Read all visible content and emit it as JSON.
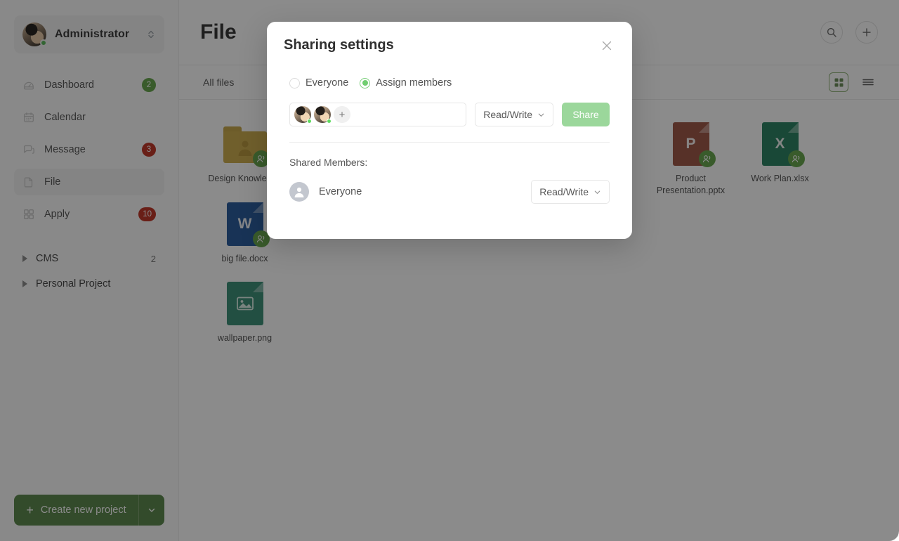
{
  "sidebar": {
    "user": {
      "name": "Administrator",
      "status": "online",
      "avatar_icon": "user-avatar",
      "switcher_icon": "chevron-up-down-icon"
    },
    "items": [
      {
        "label": "Dashboard",
        "icon": "dashboard-icon",
        "badge": "2",
        "badge_color": "#6aa84f"
      },
      {
        "label": "Calendar",
        "icon": "calendar-icon",
        "badge": "",
        "badge_color": ""
      },
      {
        "label": "Message",
        "icon": "message-icon",
        "badge": "3",
        "badge_color": "#c0392b"
      },
      {
        "label": "File",
        "icon": "file-icon",
        "badge": "",
        "badge_color": ""
      },
      {
        "label": "Apply",
        "icon": "apply-grid-icon",
        "badge": "10",
        "badge_color": "#c0392b"
      }
    ],
    "groups": [
      {
        "label": "CMS",
        "count": "2",
        "icon": "caret-right-icon"
      },
      {
        "label": "Personal Project",
        "count": "",
        "icon": "caret-right-icon"
      }
    ],
    "create_button": {
      "label": "Create new project",
      "plus_icon": "plus-icon",
      "caret_icon": "chevron-down-icon",
      "color": "#5f8a4f"
    }
  },
  "main": {
    "title": "File",
    "header_actions": [
      {
        "name": "search",
        "icon": "search-icon"
      },
      {
        "name": "add",
        "icon": "plus-icon"
      }
    ],
    "tabs": [
      {
        "label": "All files"
      }
    ],
    "view_toggles": [
      {
        "name": "grid-view",
        "icon": "grid-view-icon",
        "active": true
      },
      {
        "name": "list-view",
        "icon": "list-view-icon",
        "active": false
      }
    ],
    "files": [
      {
        "name": "Design Knowledge",
        "type": "folder",
        "glyph": "",
        "color": "#cdae52",
        "shared": true
      },
      {
        "name": "Product Presentation.pptx",
        "type": "doc",
        "glyph": "P",
        "color": "#a05a4a",
        "shared": true
      },
      {
        "name": "Work Plan.xlsx",
        "type": "doc",
        "glyph": "X",
        "color": "#2f8465",
        "shared": true
      },
      {
        "name": "big file.docx",
        "type": "doc",
        "glyph": "W",
        "color": "#2c5f9e",
        "shared": true
      },
      {
        "name": "wallpaper.png",
        "type": "image",
        "glyph": "",
        "color": "#3f917a",
        "shared": false
      }
    ]
  },
  "modal": {
    "title": "Sharing settings",
    "close_icon": "close-icon",
    "scope_options": [
      {
        "label": "Everyone",
        "selected": false
      },
      {
        "label": "Assign members",
        "selected": true
      }
    ],
    "assign": {
      "chips": [
        {
          "name": "member-avatar-1",
          "status": "online"
        },
        {
          "name": "member-avatar-2",
          "status": "online"
        }
      ],
      "add_label": "+",
      "permission": "Read/Write",
      "permission_caret": "chevron-down-icon",
      "share_label": "Share",
      "share_color": "#9bd79b"
    },
    "shared_members_label": "Shared Members:",
    "shared_members": [
      {
        "name": "Everyone",
        "permission": "Read/Write",
        "avatar_icon": "person-icon"
      }
    ]
  }
}
